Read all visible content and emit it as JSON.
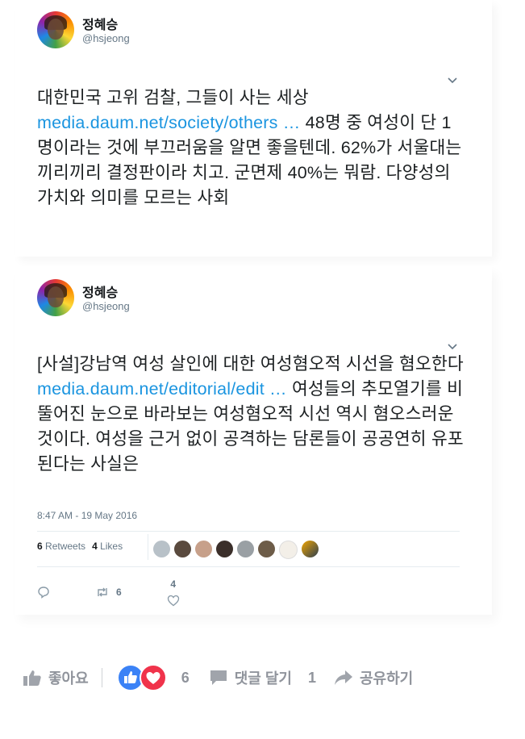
{
  "tweets": [
    {
      "author_name": "정혜승",
      "handle": "@hsjeong",
      "text_before": "대한민국 고위 검찰, 그들이 사는 세상 ",
      "link": "media.daum.net/society/others …",
      "text_after": " 48명 중 여성이 단 1명이라는 것에 부끄러움을 알면 좋을텐데. 62%가 서울대는 끼리끼리 결정판이라 치고. 군면제 40%는 뭐람. 다양성의 가치와 의미를 모르는 사회"
    },
    {
      "author_name": "정혜승",
      "handle": "@hsjeong",
      "text_before": "[사설]강남역 여성 살인에 대한 여성혐오적 시선을 혐오한다 ",
      "link": "media.daum.net/editorial/edit …",
      "text_after": " 여성들의 추모열기를 비뚤어진 눈으로 바라보는 여성혐오적 시선 역시 혐오스러운 것이다. 여성을 근거 없이 공격하는 담론들이 공공연히 유포된다는 사실은",
      "timestamp": "8:47 AM - 19 May 2016",
      "retweets_count": "6",
      "retweets_label": "Retweets",
      "likes_count": "4",
      "likes_label": "Likes",
      "action_retweet_count": "6",
      "action_like_count": "4"
    }
  ],
  "facebook_bar": {
    "like_label": "좋아요",
    "reaction_count": "6",
    "comment_label": "댓글 달기",
    "comment_count": "1",
    "share_label": "공유하기"
  },
  "colors": {
    "link": "#1b95e0",
    "fb_like_blue": "#3b82f6",
    "fb_love_red": "#f0334b"
  }
}
